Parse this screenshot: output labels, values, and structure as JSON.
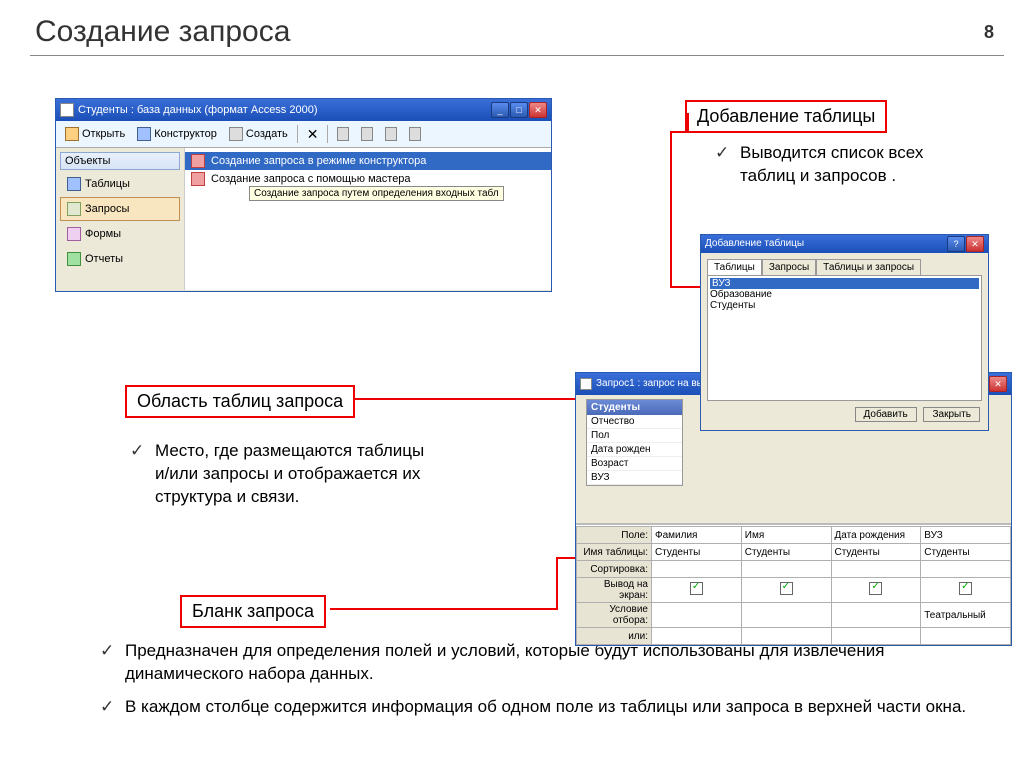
{
  "page": {
    "title": "Создание запроса",
    "number": "8"
  },
  "callouts": {
    "add_table": "Добавление таблицы",
    "table_area": "Область таблиц запроса",
    "blank": "Бланк запроса"
  },
  "text": {
    "add_list": "Выводится список всех таблиц и запросов .",
    "area_desc": "Место, где размещаются таблицы и/или запросы и отображается их структура и связи.",
    "blank_desc1": "Предназначен для определения полей и условий, которые будут использованы для извлечения динамического набора данных.",
    "blank_desc2": "В каждом столбце содержится информация об одном поле из таблицы или запроса в верхней части окна."
  },
  "db_window": {
    "title": "Студенты : база данных (формат Access 2000)",
    "toolbar": {
      "open": "Открыть",
      "design": "Конструктор",
      "create": "Создать"
    },
    "left_header": "Объекты",
    "left_items": [
      "Таблицы",
      "Запросы",
      "Формы",
      "Отчеты"
    ],
    "right_items": [
      "Создание запроса в режиме конструктора",
      "Создание запроса с помощью мастера"
    ],
    "tooltip": "Создание запроса путем определения входных табл"
  },
  "add_dialog": {
    "title": "Добавление таблицы",
    "tabs": [
      "Таблицы",
      "Запросы",
      "Таблицы и запросы"
    ],
    "items": [
      "ВУЗ",
      "Образование",
      "Студенты"
    ],
    "btn_add": "Добавить",
    "btn_close": "Закрыть"
  },
  "query_window": {
    "title": "Запрос1 : запрос на выборку",
    "table_name": "Студенты",
    "table_fields": [
      "Отчество",
      "Пол",
      "Дата рожден",
      "Возраст",
      "ВУЗ"
    ],
    "grid": {
      "rows": [
        "Поле:",
        "Имя таблицы:",
        "Сортировка:",
        "Вывод на экран:",
        "Условие отбора:",
        "или:"
      ],
      "cols": [
        "Фамилия",
        "Имя",
        "Дата рождения",
        "ВУЗ"
      ],
      "tables": [
        "Студенты",
        "Студенты",
        "Студенты",
        "Студенты"
      ],
      "condition": "Театральный"
    }
  }
}
